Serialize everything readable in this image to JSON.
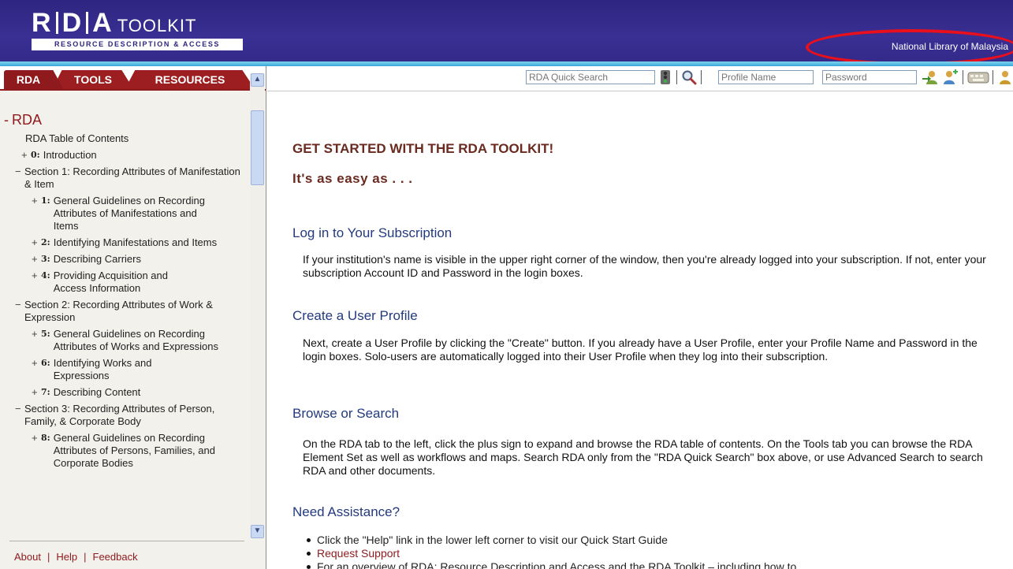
{
  "header": {
    "logo_letters": "R|D|A",
    "logo_toolkit": "TOOLKIT",
    "logo_subtitle": "RESOURCE DESCRIPTION & ACCESS",
    "institution": "National Library of Malaysia"
  },
  "sidebar": {
    "tabs": [
      {
        "label": "RDA"
      },
      {
        "label": "TOOLS"
      },
      {
        "label": "RESOURCES"
      }
    ],
    "toc_heading": "RDA",
    "toc_heading_sign": "-",
    "items": [
      {
        "sign": "",
        "num": "",
        "text": "RDA Table of Contents"
      },
      {
        "sign": "+",
        "num": "0:",
        "text": "Introduction"
      },
      {
        "sign": "−",
        "num": "",
        "text": "Section 1: Recording Attributes of Manifestation & Item"
      },
      {
        "sign": "+",
        "num": "1:",
        "text": "General Guidelines on Recording Attributes of Manifestations and Items"
      },
      {
        "sign": "+",
        "num": "2:",
        "text": "Identifying Manifestations and Items"
      },
      {
        "sign": "+",
        "num": "3:",
        "text": "Describing Carriers"
      },
      {
        "sign": "+",
        "num": "4:",
        "text": "Providing Acquisition and Access Information"
      },
      {
        "sign": "−",
        "num": "",
        "text": "Section 2: Recording Attributes of Work & Expression"
      },
      {
        "sign": "+",
        "num": "5:",
        "text": "General Guidelines on Recording Attributes of Works and Expressions"
      },
      {
        "sign": "+",
        "num": "6:",
        "text": "Identifying Works and Expressions"
      },
      {
        "sign": "+",
        "num": "7:",
        "text": "Describing Content"
      },
      {
        "sign": "−",
        "num": "",
        "text": "Section 3: Recording Attributes of Person, Family, & Corporate Body"
      },
      {
        "sign": "+",
        "num": "8:",
        "text": "General Guidelines on Recording Attributes of Persons, Families, and Corporate Bodies"
      }
    ],
    "footer": {
      "about": "About",
      "help": "Help",
      "feedback": "Feedback",
      "sep": "|"
    }
  },
  "toolbar": {
    "quick_search_placeholder": "RDA Quick Search",
    "profile_name_placeholder": "Profile Name",
    "password_placeholder": "Password",
    "icons": [
      "search-go-icon",
      "magnifier-icon",
      "login-icon",
      "create-profile-icon",
      "keyboard-icon"
    ]
  },
  "main": {
    "title": "GET STARTED WITH THE RDA TOOLKIT!",
    "subtitle": "It's as easy as . . .",
    "sections": [
      {
        "heading": "Log in to Your Subscription",
        "body": "If your institution's name is visible in the upper right corner of the window, then you're already logged into your subscription. If not, enter your subscription Account ID and Password in the login boxes."
      },
      {
        "heading": "Create a User Profile",
        "body": "Next, create a User Profile by clicking the \"Create\" button. If you already have a User Profile, enter your Profile Name and Password in the login boxes. Solo-users are automatically logged into their User Profile when they log into their subscription."
      },
      {
        "heading": "Browse or Search",
        "body": "On the RDA tab to the left, click the plus sign to expand and browse the RDA table of contents. On the Tools tab you can browse the RDA Element Set as well as workflows and maps. Search RDA only from the \"RDA Quick Search\" box above, or use Advanced Search to search RDA and other documents."
      },
      {
        "heading": "Need Assistance?",
        "body": ""
      }
    ],
    "assistance_bullets": [
      {
        "text": "Click the \"Help\" link in the lower left corner to visit our Quick Start Guide",
        "link": false
      },
      {
        "text": "Request Support",
        "link": true
      },
      {
        "text": "For an overview of RDA: Resource Description and Access and the RDA Toolkit – including how to",
        "link": false
      }
    ]
  },
  "colors": {
    "header_bg": "#332a8a",
    "tab_red": "#9c1e21",
    "heading_brown": "#6b2a20",
    "section_blue": "#233a7e",
    "highlight_ring": "#e8101c"
  }
}
